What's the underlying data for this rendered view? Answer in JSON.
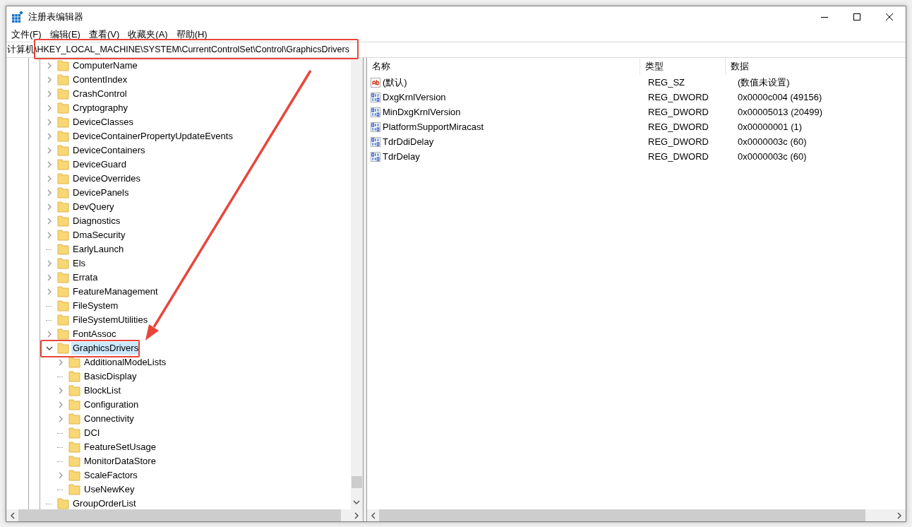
{
  "window": {
    "title": "注册表编辑器"
  },
  "menu": [
    "文件(F)",
    "编辑(E)",
    "查看(V)",
    "收藏夹(A)",
    "帮助(H)"
  ],
  "address": "计算机\\HKEY_LOCAL_MACHINE\\SYSTEM\\CurrentControlSet\\Control\\GraphicsDrivers",
  "tree": [
    {
      "label": "ComputerName",
      "kind": "branch",
      "expanded": false,
      "selected": false
    },
    {
      "label": "ContentIndex",
      "kind": "branch",
      "expanded": false,
      "selected": false
    },
    {
      "label": "CrashControl",
      "kind": "branch",
      "expanded": false,
      "selected": false
    },
    {
      "label": "Cryptography",
      "kind": "branch",
      "expanded": false,
      "selected": false
    },
    {
      "label": "DeviceClasses",
      "kind": "branch",
      "expanded": false,
      "selected": false
    },
    {
      "label": "DeviceContainerPropertyUpdateEvents",
      "kind": "branch",
      "expanded": false,
      "selected": false
    },
    {
      "label": "DeviceContainers",
      "kind": "branch",
      "expanded": false,
      "selected": false
    },
    {
      "label": "DeviceGuard",
      "kind": "branch",
      "expanded": false,
      "selected": false
    },
    {
      "label": "DeviceOverrides",
      "kind": "branch",
      "expanded": false,
      "selected": false
    },
    {
      "label": "DevicePanels",
      "kind": "branch",
      "expanded": false,
      "selected": false
    },
    {
      "label": "DevQuery",
      "kind": "branch",
      "expanded": false,
      "selected": false
    },
    {
      "label": "Diagnostics",
      "kind": "branch",
      "expanded": false,
      "selected": false
    },
    {
      "label": "DmaSecurity",
      "kind": "branch",
      "expanded": false,
      "selected": false
    },
    {
      "label": "EarlyLaunch",
      "kind": "leaf",
      "selected": false
    },
    {
      "label": "Els",
      "kind": "branch",
      "expanded": false,
      "selected": false
    },
    {
      "label": "Errata",
      "kind": "branch",
      "expanded": false,
      "selected": false
    },
    {
      "label": "FeatureManagement",
      "kind": "branch",
      "expanded": false,
      "selected": false
    },
    {
      "label": "FileSystem",
      "kind": "leaf",
      "selected": false
    },
    {
      "label": "FileSystemUtilities",
      "kind": "leaf",
      "selected": false
    },
    {
      "label": "FontAssoc",
      "kind": "branch",
      "expanded": false,
      "selected": false
    },
    {
      "label": "GraphicsDrivers",
      "kind": "branch",
      "expanded": true,
      "selected": true,
      "children": [
        {
          "label": "AdditionalModeLists",
          "kind": "branch",
          "expanded": false,
          "selected": false
        },
        {
          "label": "BasicDisplay",
          "kind": "leaf",
          "selected": false
        },
        {
          "label": "BlockList",
          "kind": "branch",
          "expanded": false,
          "selected": false
        },
        {
          "label": "Configuration",
          "kind": "branch",
          "expanded": false,
          "selected": false
        },
        {
          "label": "Connectivity",
          "kind": "branch",
          "expanded": false,
          "selected": false
        },
        {
          "label": "DCI",
          "kind": "leaf",
          "selected": false
        },
        {
          "label": "FeatureSetUsage",
          "kind": "leaf",
          "selected": false
        },
        {
          "label": "MonitorDataStore",
          "kind": "leaf",
          "selected": false
        },
        {
          "label": "ScaleFactors",
          "kind": "branch",
          "expanded": false,
          "selected": false
        },
        {
          "label": "UseNewKey",
          "kind": "leaf",
          "selected": false
        }
      ]
    },
    {
      "label": "GroupOrderList",
      "kind": "leaf",
      "selected": false
    }
  ],
  "table": {
    "columns": [
      "名称",
      "类型",
      "数据"
    ],
    "rows": [
      {
        "kind": "string",
        "name": "(默认)",
        "type": "REG_SZ",
        "data": "(数值未设置)"
      },
      {
        "kind": "binary",
        "name": "DxgKrnlVersion",
        "type": "REG_DWORD",
        "data": "0x0000c004 (49156)"
      },
      {
        "kind": "binary",
        "name": "MinDxgKrnlVersion",
        "type": "REG_DWORD",
        "data": "0x00005013 (20499)"
      },
      {
        "kind": "binary",
        "name": "PlatformSupportMiracast",
        "type": "REG_DWORD",
        "data": "0x00000001 (1)"
      },
      {
        "kind": "binary",
        "name": "TdrDdiDelay",
        "type": "REG_DWORD",
        "data": "0x0000003c (60)"
      },
      {
        "kind": "binary",
        "name": "TdrDelay",
        "type": "REG_DWORD",
        "data": "0x0000003c (60)"
      }
    ]
  }
}
